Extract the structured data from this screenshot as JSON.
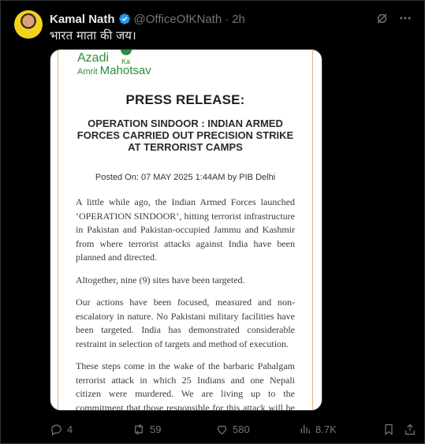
{
  "tweet": {
    "author_name": "Kamal Nath",
    "handle": "@OfficeOfKNath",
    "separator": "·",
    "time": "2h",
    "text": "भारत माता की जय।"
  },
  "press_release": {
    "logo": {
      "line1": "Azadi",
      "ka": "Ka",
      "line2a": "Amrit",
      "line2b": "Mahotsav"
    },
    "heading": "PRESS RELEASE:",
    "title": "OPERATION SINDOOR : INDIAN ARMED FORCES CARRIED OUT PRECISION STRIKE AT TERRORIST CAMPS",
    "posted_on": "Posted On: 07 MAY 2025 1:44AM by PIB Delhi",
    "paragraphs": [
      "A little while ago, the Indian Armed Forces launched ‘OPERATION SINDOOR’, hitting terrorist infrastructure in Pakistan and Pakistan-occupied Jammu and Kashmir from where terrorist attacks against India have been planned and directed.",
      "Altogether, nine (9) sites have been targeted.",
      "Our actions have been focused, measured and non-escalatory in nature. No Pakistani military facilities have been targeted. India has demonstrated considerable restraint in selection of targets and method of execution.",
      "These steps come in the wake of the barbaric Pahalgam terrorist attack in which 25 Indians and one Nepali citizen were murdered. We are living up to the commitment that those responsible for this attack will be held accountable."
    ]
  },
  "actions": {
    "replies": "4",
    "reposts": "59",
    "likes": "580",
    "views": "8.7K"
  },
  "icons": {
    "verified": "verified-badge-icon",
    "grok": "grok-icon",
    "more": "more-icon",
    "reply": "reply-icon",
    "repost": "repost-icon",
    "like": "like-icon",
    "views": "views-icon",
    "bookmark": "bookmark-icon",
    "share": "share-icon"
  },
  "colors": {
    "background": "#000000",
    "text": "#e7e9ea",
    "muted": "#71767b",
    "verified": "#1d9bf0",
    "logo_green": "#2e8b3d"
  }
}
